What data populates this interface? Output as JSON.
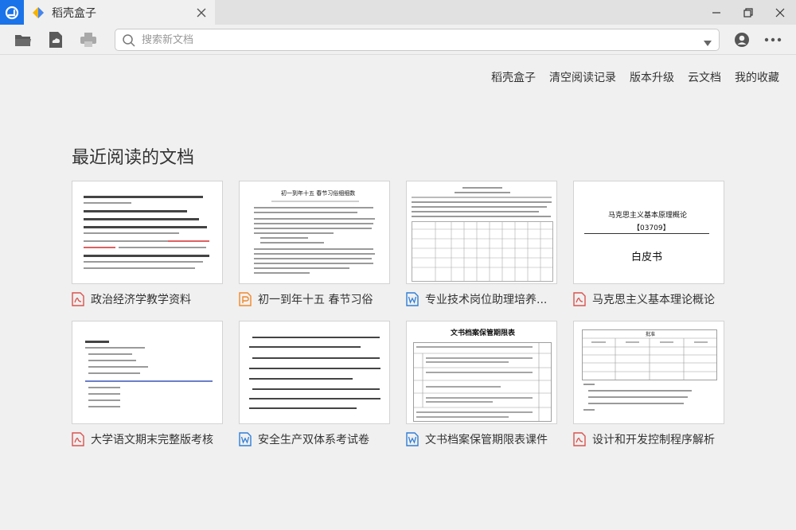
{
  "app": {
    "tab_title": "稻壳盒子"
  },
  "search": {
    "placeholder": "搜索新文档"
  },
  "top_links": [
    "稻壳盒子",
    "清空阅读记录",
    "版本升级",
    "云文档",
    "我的收藏"
  ],
  "section_title": "最近阅读的文档",
  "docs": [
    {
      "name": "政治经济学教学资料",
      "type": "pdf-icon"
    },
    {
      "name": "初一到年十五 春节习俗",
      "type": "ppt-icon"
    },
    {
      "name": "专业技术岗位助理培养...",
      "type": "word-icon"
    },
    {
      "name": "马克思主义基本理论概论",
      "type": "pdf-icon"
    },
    {
      "name": "大学语文期末完整版考核",
      "type": "pdf-icon"
    },
    {
      "name": "安全生产双体系考试卷",
      "type": "word-icon"
    },
    {
      "name": "文书档案保管期限表课件",
      "type": "word-icon"
    },
    {
      "name": "设计和开发控制程序解析",
      "type": "pdf-icon"
    }
  ],
  "thumbs": {
    "t2_title": "初一到年十五 春节习俗细细数",
    "t4_title": "马克思主义基本原理概论",
    "t4_code": "【03709】",
    "t4_sub": "白皮书",
    "t7_title": "文书档案保管期限表",
    "t8_title": "批准"
  },
  "colors": {
    "accent": "#1a73e8",
    "pdf": "#d9534f",
    "ppt": "#f0882a",
    "word": "#2f7ed8"
  }
}
